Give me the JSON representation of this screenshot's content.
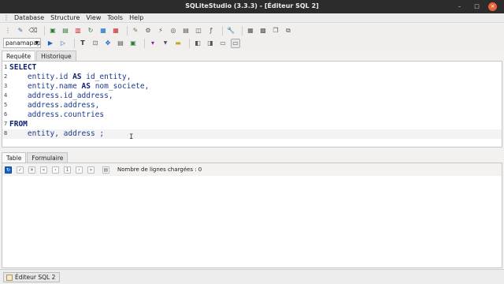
{
  "window": {
    "title": "SQLiteStudio (3.3.3) - [Éditeur SQL 2]"
  },
  "menubar": {
    "items": [
      "Database",
      "Structure",
      "View",
      "Tools",
      "Help"
    ]
  },
  "db_select": {
    "value": "panamapapers"
  },
  "editor_tabs": [
    "Requête",
    "Historique"
  ],
  "editor": {
    "line_numbers": [
      "1",
      "2",
      "3",
      "4",
      "5",
      "6",
      "7",
      "8"
    ],
    "keywords": {
      "select": "SELECT",
      "from": "FROM",
      "as": "AS"
    },
    "lines": [
      {
        "pre": "",
        "post": ""
      },
      {
        "pre": "    entity.id ",
        "post": " id_entity,"
      },
      {
        "pre": "    entity.name ",
        "post": " nom_societe,"
      },
      {
        "pre": "    address.id_address,",
        "post": ""
      },
      {
        "pre": "    address.address,",
        "post": ""
      },
      {
        "pre": "    address.countries",
        "post": ""
      },
      {
        "pre": "",
        "post": ""
      },
      {
        "pre": "    entity, address ;",
        "post": ""
      }
    ]
  },
  "result_tabs": [
    "Table",
    "Formulaire"
  ],
  "results": {
    "row_count_label": "Nombre de lignes chargées : 0",
    "page_number": "1"
  },
  "statusbar": {
    "window_label": "Éditeur SQL 2"
  },
  "colors": {
    "titlebar": "#2c2c2c",
    "keyword": "#0c1f6e",
    "code": "#1b3a8a"
  }
}
